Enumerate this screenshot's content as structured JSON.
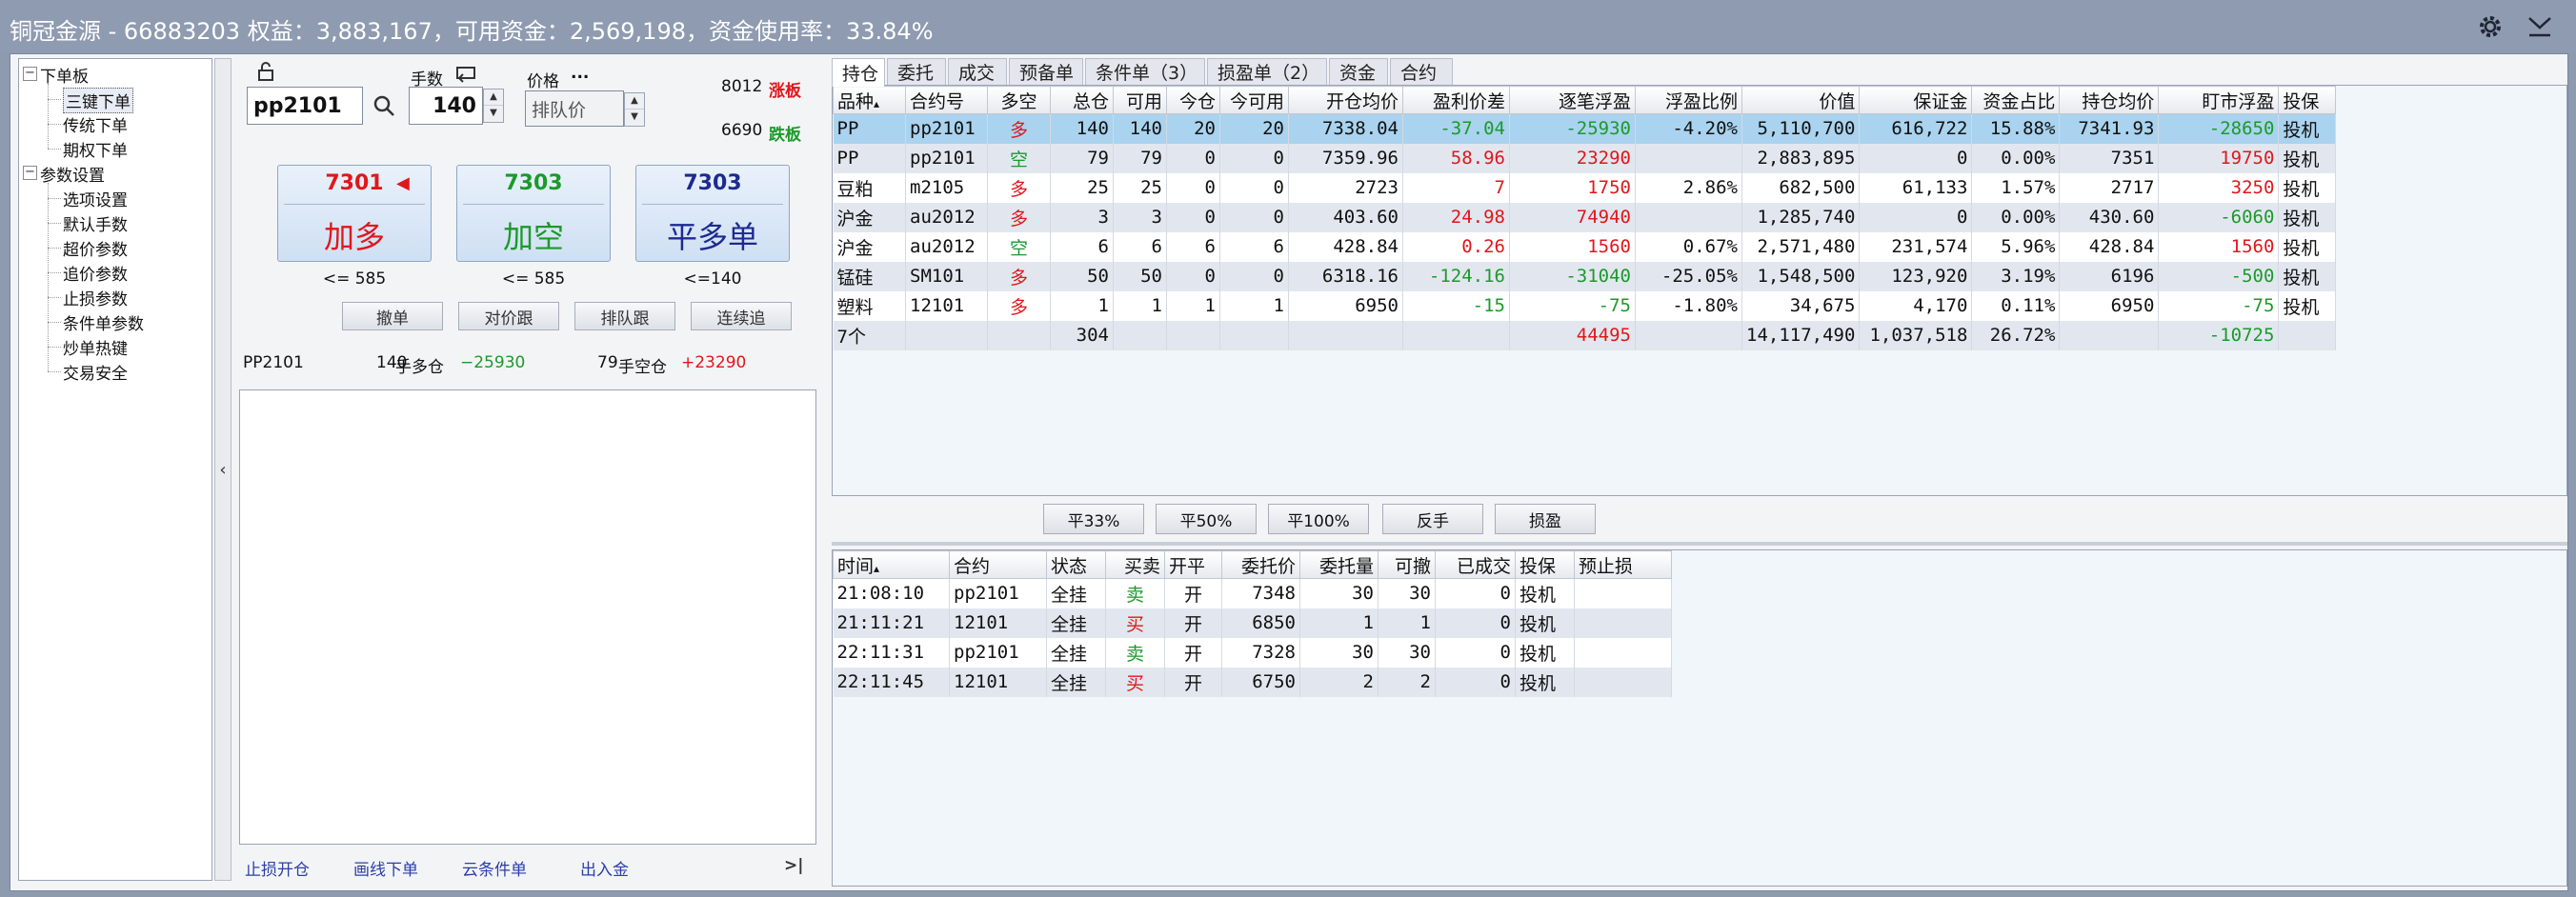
{
  "window": {
    "title": "铜冠金源 - 66883203  权益：3,883,167，可用资金：2,569,198，资金使用率：33.84%"
  },
  "tree": {
    "groups": [
      {
        "label": "下单板",
        "items": [
          "三键下单",
          "传统下单",
          "期权下单"
        ]
      },
      {
        "label": "参数设置",
        "items": [
          "选项设置",
          "默认手数",
          "超价参数",
          "追价参数",
          "止损参数",
          "条件单参数",
          "炒单热键",
          "交易安全"
        ]
      }
    ]
  },
  "order": {
    "contract": "pp2101",
    "qty_label": "手数",
    "qty": "140",
    "price_label": "价格",
    "price_dots": "...",
    "price_placeholder": "排队价",
    "limit_up": "8012",
    "limit_up_label": "涨板",
    "limit_down": "6690",
    "limit_down_label": "跌板",
    "buttons": [
      {
        "price": "7301",
        "action": "加多",
        "under": "<= 585",
        "color": "#e0171b"
      },
      {
        "price": "7303",
        "action": "加空",
        "under": "<= 585",
        "color": "#1c9a2a"
      },
      {
        "price": "7303",
        "action": "平多单",
        "under": "<=140",
        "color": "#1d2a8f"
      }
    ],
    "small_buttons": [
      "撤单",
      "对价跟",
      "排队跟",
      "连续追"
    ],
    "summary": {
      "contract": "PP2101",
      "long_qty": "140",
      "long_label": "手多仓",
      "long_pnl": "−25930",
      "short_qty": "79",
      "short_label": "手空仓",
      "short_pnl": "+23290"
    },
    "links": [
      "止损开仓",
      "画线下单",
      "云条件单",
      "出入金"
    ],
    "end_icon": ">|"
  },
  "tabs": [
    "持仓",
    "委托",
    "成交",
    "预备单",
    "条件单（3）",
    "损盈单（2）",
    "资金",
    "合约"
  ],
  "positions": {
    "columns": [
      "品种",
      "合约号",
      "多空",
      "总仓",
      "可用",
      "今仓",
      "今可用",
      "开仓均价",
      "盈利价差",
      "逐笔浮盈",
      "浮盈比例",
      "价值",
      "保证金",
      "资金占比",
      "持仓均价",
      "盯市浮盈",
      "投保"
    ],
    "rows": [
      [
        "PP",
        "pp2101",
        "多",
        "140",
        "140",
        "20",
        "20",
        "7338.04",
        "-37.04",
        "-25930",
        "-4.20%",
        "5,110,700",
        "616,722",
        "15.88%",
        "7341.93",
        "-28650",
        "投机"
      ],
      [
        "PP",
        "pp2101",
        "空",
        "79",
        "79",
        "0",
        "0",
        "7359.96",
        "58.96",
        "23290",
        "",
        "2,883,895",
        "0",
        "0.00%",
        "7351",
        "19750",
        "投机"
      ],
      [
        "豆粕",
        "m2105",
        "多",
        "25",
        "25",
        "0",
        "0",
        "2723",
        "7",
        "1750",
        "2.86%",
        "682,500",
        "61,133",
        "1.57%",
        "2717",
        "3250",
        "投机"
      ],
      [
        "沪金",
        "au2012",
        "多",
        "3",
        "3",
        "0",
        "0",
        "403.60",
        "24.98",
        "74940",
        "",
        "1,285,740",
        "0",
        "0.00%",
        "430.60",
        "-6060",
        "投机"
      ],
      [
        "沪金",
        "au2012",
        "空",
        "6",
        "6",
        "6",
        "6",
        "428.84",
        "0.26",
        "1560",
        "0.67%",
        "2,571,480",
        "231,574",
        "5.96%",
        "428.84",
        "1560",
        "投机"
      ],
      [
        "锰硅",
        "SM101",
        "多",
        "50",
        "50",
        "0",
        "0",
        "6318.16",
        "-124.16",
        "-31040",
        "-25.05%",
        "1,548,500",
        "123,920",
        "3.19%",
        "6196",
        "-500",
        "投机"
      ],
      [
        "塑料",
        "12101",
        "多",
        "1",
        "1",
        "1",
        "1",
        "6950",
        "-15",
        "-75",
        "-1.80%",
        "34,675",
        "4,170",
        "0.11%",
        "6950",
        "-75",
        "投机"
      ]
    ],
    "total": [
      "7个",
      "",
      "",
      "304",
      "",
      "",
      "",
      "",
      "",
      "44495",
      "",
      "14,117,490",
      "1,037,518",
      "26.72%",
      "",
      "-10725",
      ""
    ]
  },
  "action_buttons": [
    "平33%",
    "平50%",
    "平100%",
    "反手",
    "损盈"
  ],
  "orders": {
    "columns": [
      "时间",
      "合约",
      "状态",
      "买卖",
      "开平",
      "委托价",
      "委托量",
      "可撤",
      "已成交",
      "投保",
      "预止损"
    ],
    "rows": [
      [
        "21:08:10",
        "pp2101",
        "全挂",
        "卖",
        "开",
        "7348",
        "30",
        "30",
        "0",
        "投机",
        ""
      ],
      [
        "21:11:21",
        "12101",
        "全挂",
        "买",
        "开",
        "6850",
        "1",
        "1",
        "0",
        "投机",
        ""
      ],
      [
        "22:11:31",
        "pp2101",
        "全挂",
        "卖",
        "开",
        "7328",
        "30",
        "30",
        "0",
        "投机",
        ""
      ],
      [
        "22:11:45",
        "12101",
        "全挂",
        "买",
        "开",
        "6750",
        "2",
        "2",
        "0",
        "投机",
        ""
      ]
    ]
  }
}
